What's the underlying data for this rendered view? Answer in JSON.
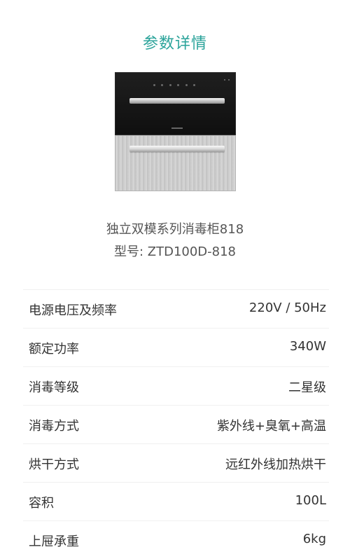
{
  "section_title": "参数详情",
  "product": {
    "name": "独立双模系列消毒柜818",
    "model": "型号: ZTD100D-818"
  },
  "specs": [
    {
      "label": "电源电压及频率",
      "value": "220V / 50Hz"
    },
    {
      "label": "额定功率",
      "value": "340W"
    },
    {
      "label": "消毒等级",
      "value": "二星级"
    },
    {
      "label": "消毒方式",
      "value": "紫外线+臭氧+高温"
    },
    {
      "label": "烘干方式",
      "value": "远红外线加热烘干"
    },
    {
      "label": "容积",
      "value": "100L"
    },
    {
      "label": "上屉承重",
      "value": "6kg"
    }
  ],
  "colors": {
    "accent": "#2aa39a",
    "text": "#333333",
    "divider": "#f0f0f0"
  }
}
